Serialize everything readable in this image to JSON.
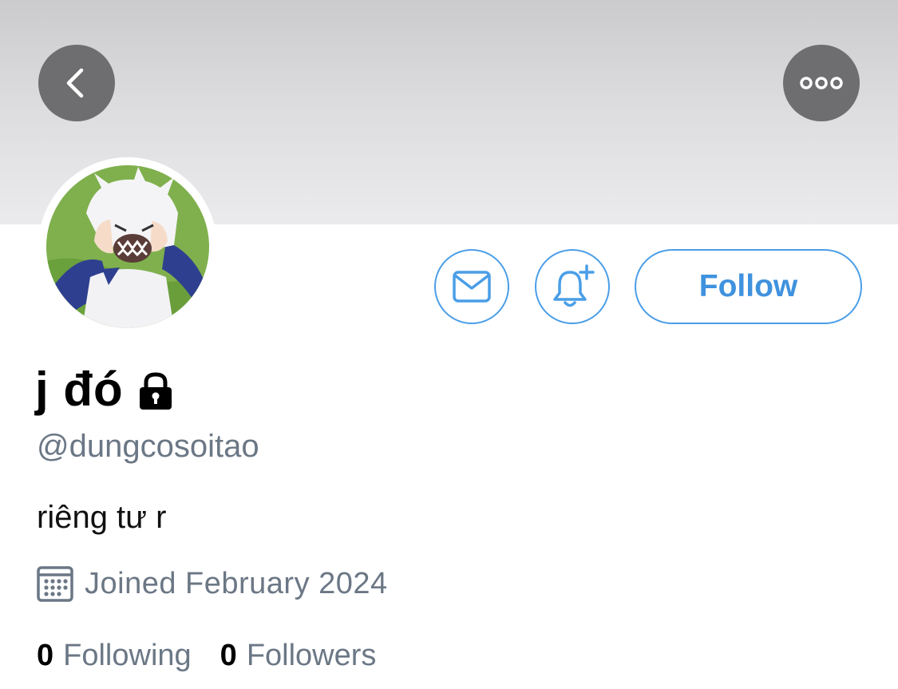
{
  "header": {
    "back_icon": "chevron-left-icon",
    "more_icon": "more-horizontal-icon",
    "button_color": "#6e6e70"
  },
  "profile": {
    "display_name": "j đó",
    "protected_icon": "lock-icon",
    "handle": "@dungcosoitao",
    "bio": "riêng tư r",
    "joined_icon": "calendar-icon",
    "joined": "Joined February 2024",
    "following_count": "0",
    "following_label": "Following",
    "followers_count": "0",
    "followers_label": "Followers"
  },
  "actions": {
    "message_icon": "mail-icon",
    "notify_icon": "bell-plus-icon",
    "follow_label": "Follow",
    "accent_color": "#4a9ee7"
  }
}
